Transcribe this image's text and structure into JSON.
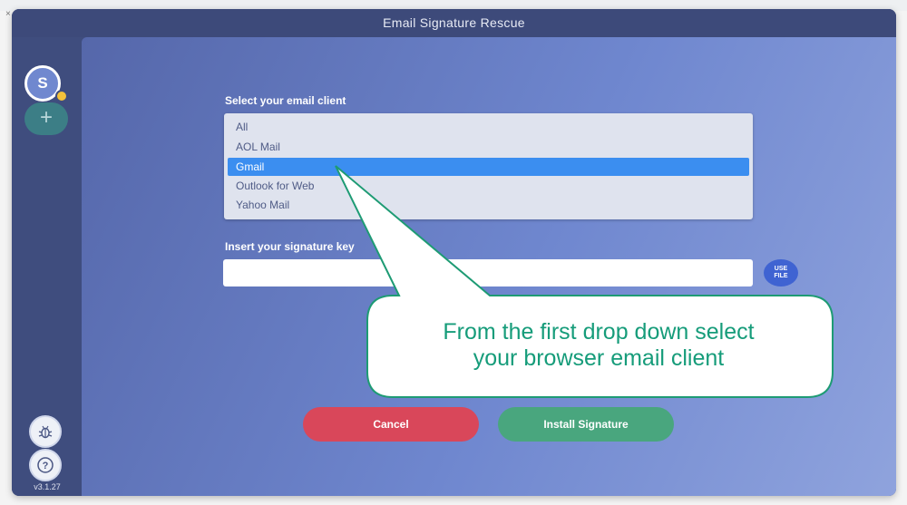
{
  "window": {
    "title": "Email Signature Rescue"
  },
  "sidebar": {
    "avatar_letter": "S",
    "add_symbol": "+",
    "version": "v3.1.27",
    "icons": [
      "bug-icon",
      "help-icon",
      "close-icon",
      "plus-icon"
    ]
  },
  "form": {
    "client_label": "Select your email client",
    "clients": [
      "All",
      "AOL Mail",
      "Gmail",
      "Outlook for Web",
      "Yahoo Mail"
    ],
    "selected_client": "Gmail",
    "key_label": "Insert your signature key",
    "key_value": "",
    "use_file_line1": "USE",
    "use_file_line2": "FILE"
  },
  "actions": {
    "cancel_label": "Cancel",
    "install_label": "Install Signature"
  },
  "callout": {
    "line1": "From the first drop down select",
    "line2": "your browser email client"
  },
  "colors": {
    "selected_option": "#3b8ef0",
    "cancel": "#d9475a",
    "install": "#49a67e",
    "callout_text": "#169c7a",
    "callout_border": "#1e9b74"
  }
}
